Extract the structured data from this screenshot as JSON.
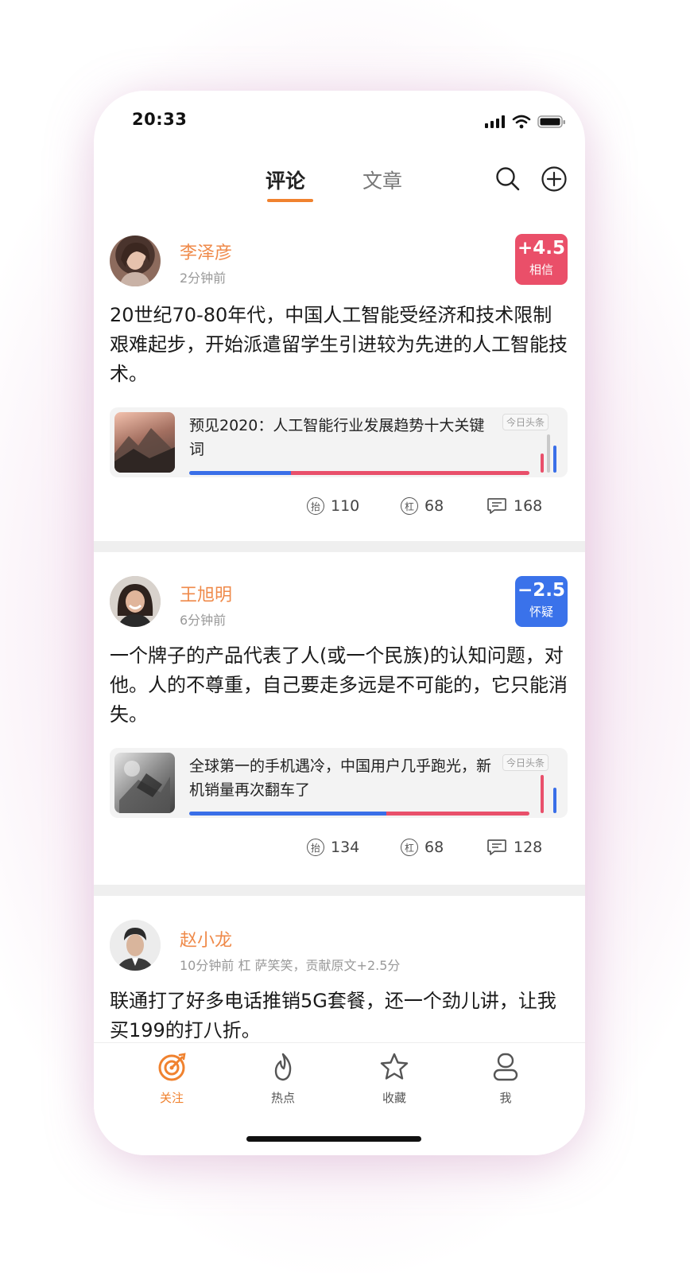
{
  "status": {
    "time": "20:33"
  },
  "nav": {
    "tabs": [
      "评论",
      "文章"
    ],
    "active_tab": 0
  },
  "posts": [
    {
      "author": "李泽彦",
      "meta": "2分钟前",
      "score": "+4.5",
      "score_label": "相信",
      "score_color": "#ea4f69",
      "text": "20世纪70-80年代，中国人工智能受经济和技术限制艰难起步，开始派遣留学生引进较为先进的人工智能技术。",
      "article": {
        "title": "预见2020：人工智能行业发展趋势十大关键词",
        "source": "今日头条",
        "blue_share": 0.3
      },
      "stats": {
        "lift": "110",
        "bar": "68",
        "comments": "168"
      }
    },
    {
      "author": "王旭明",
      "meta": "6分钟前",
      "score": "−2.5",
      "score_label": "怀疑",
      "score_color": "#3a72ea",
      "text": "一个牌子的产品代表了人(或一个民族)的认知问题，对他。人的不尊重，自己要走多远是不可能的，它只能消失。",
      "article": {
        "title": "全球第一的手机遇冷，中国用户几乎跑光，新机销量再次翻车了",
        "source": "今日头条",
        "blue_share": 0.58
      },
      "stats": {
        "lift": "134",
        "bar": "68",
        "comments": "128"
      }
    },
    {
      "author": "赵小龙",
      "meta": "10分钟前  杠 萨笑笑，贡献原文+2.5分",
      "text": "联通打了好多电话推销5G套餐，还一个劲儿讲，让我买199的打八折。"
    }
  ],
  "tabbar": {
    "items": [
      {
        "label": "关注",
        "icon": "target-icon",
        "active": true
      },
      {
        "label": "热点",
        "icon": "flame-icon",
        "active": false
      },
      {
        "label": "收藏",
        "icon": "star-icon",
        "active": false
      },
      {
        "label": "我",
        "icon": "profile-icon",
        "active": false
      }
    ]
  },
  "colors": {
    "accent": "#f0822f",
    "author": "#ef8a4a",
    "believe": "#ea4f69",
    "doubt": "#3a72ea"
  }
}
